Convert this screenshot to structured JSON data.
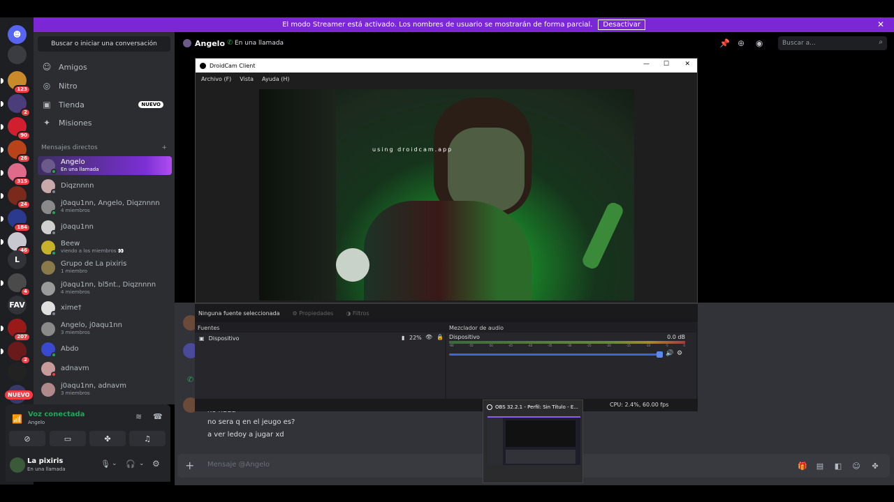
{
  "banner": {
    "text": "El modo Streamer está activado. Los nombres de usuario se mostrarán de forma parcial.",
    "button": "Desactivar",
    "color": "#7b27d6"
  },
  "servers": [
    {
      "label": "",
      "badge": "",
      "color": "#5865f2",
      "icon": "discord-icon"
    },
    {
      "label": "",
      "badge": "",
      "color": "#3a3c42"
    },
    {
      "label": "",
      "badge": "123",
      "color": "#c98a2a"
    },
    {
      "label": "",
      "badge": "2",
      "color": "#4b3d7a"
    },
    {
      "label": "",
      "badge": "90",
      "color": "#d21f2f"
    },
    {
      "label": "",
      "badge": "26",
      "color": "#b8421a"
    },
    {
      "label": "",
      "badge": "315",
      "color": "#e06a8a"
    },
    {
      "label": "",
      "badge": "24",
      "color": "#7a2a1a"
    },
    {
      "label": "",
      "badge": "184",
      "color": "#2b3a8f"
    },
    {
      "label": "",
      "badge": "46",
      "color": "#c8c8d0"
    },
    {
      "label": "L",
      "badge": "",
      "color": "#313338"
    },
    {
      "label": "",
      "badge": "4",
      "color": "#4a4a4a"
    },
    {
      "label": "FAV",
      "badge": "",
      "color": "#313338"
    },
    {
      "label": "",
      "badge": "207",
      "color": "#9a1a1a"
    },
    {
      "label": "",
      "badge": "2",
      "color": "#6a1a1a"
    },
    {
      "label": "",
      "badge": "",
      "color": "#222"
    },
    {
      "label": "",
      "badge": "",
      "color": "#3a3a6a"
    }
  ],
  "rail_new": "NUEVO",
  "dm_panel": {
    "search_label": "Buscar o iniciar una conversación",
    "nav": [
      {
        "label": "Amigos",
        "icon": "friends-icon"
      },
      {
        "label": "Nitro",
        "icon": "nitro-icon"
      },
      {
        "label": "Tienda",
        "icon": "shop-icon",
        "tag": "NUEVO"
      },
      {
        "label": "Misiones",
        "icon": "quests-icon"
      }
    ],
    "header": "Mensajes directos",
    "add": "+",
    "dms": [
      {
        "name": "Angelo",
        "sub": "En una llamada",
        "active": true,
        "color": "#6b5a8a",
        "status": "#23a55a"
      },
      {
        "name": "Diqznnnn",
        "sub": "",
        "color": "#c9a9a9",
        "status": "#80848e"
      },
      {
        "name": "j0aqu1nn, Angelo, Diqznnnn",
        "sub": "4 miembros",
        "color": "#8a8a8a",
        "status": "#23a55a"
      },
      {
        "name": "j0aqu1nn",
        "sub": "",
        "color": "#d0d0d0",
        "status": "#80848e"
      },
      {
        "name": "Beew",
        "sub": "viendo a los miembros 👀",
        "color": "#c8b22a",
        "status": "#23a55a"
      },
      {
        "name": "Grupo de La pixiris",
        "sub": "1 miembro",
        "color": "#8a7a4a",
        "status": ""
      },
      {
        "name": "j0aqu1nn, bl5nt., Diqznnnn",
        "sub": "4 miembros",
        "color": "#9a9a9a",
        "status": ""
      },
      {
        "name": "xime†",
        "sub": "",
        "color": "#e0e0e0",
        "status": "#80848e"
      },
      {
        "name": "Angelo, j0aqu1nn",
        "sub": "3 miembros",
        "color": "#8a8a8a",
        "status": ""
      },
      {
        "name": "Abdo",
        "sub": "",
        "color": "#3a4ad0",
        "status": "#23a55a"
      },
      {
        "name": "adnavm",
        "sub": "",
        "color": "#c99a9a",
        "status": "#f23f43"
      },
      {
        "name": "j0aqu1nn, adnavm",
        "sub": "3 miembros",
        "color": "#b08a8a",
        "status": ""
      }
    ]
  },
  "voice": {
    "title": "Voz conectada",
    "channel": "Angelo"
  },
  "user": {
    "name": "La pixiris",
    "status": "En una llamada"
  },
  "channel_header": {
    "name": "Angelo",
    "status": "En una llamada",
    "search_placeholder": "Buscar a..."
  },
  "droidcam": {
    "title": "DroidCam Client",
    "menu": [
      "Archivo (F)",
      "Vista",
      "Ayuda (H)"
    ],
    "watermark": "using droidcam.app",
    "controls": [
      "—",
      "☐",
      "✕"
    ]
  },
  "obs": {
    "no_source": "Ninguna fuente seleccionada",
    "props": "Propiedades",
    "filters": "Filtros",
    "sources_header": "Fuentes",
    "source_name": "Dispositivo",
    "source_pct": "22%",
    "mixer_header": "Mezclador de audio",
    "mixer_device": "Dispositivo",
    "mixer_db": "0.0 dB",
    "ticks": [
      "-60",
      "-55",
      "-50",
      "-45",
      "-40",
      "-35",
      "-30",
      "-25",
      "-20",
      "-15",
      "-10",
      "-5",
      "0"
    ],
    "cpu": "CPU: 2.4%, 60.00 fps",
    "volume": 1.0
  },
  "thumbnail": {
    "title": "OBS 32.2.1 - Perfil: Sin Título - E..."
  },
  "messages": [
    {
      "text": "no nada"
    },
    {
      "text": "no sera q en el jeugo es?"
    },
    {
      "text": "a ver ledoy a jugar xd"
    }
  ],
  "composer": {
    "placeholder": "Mensaje @Angelo"
  }
}
